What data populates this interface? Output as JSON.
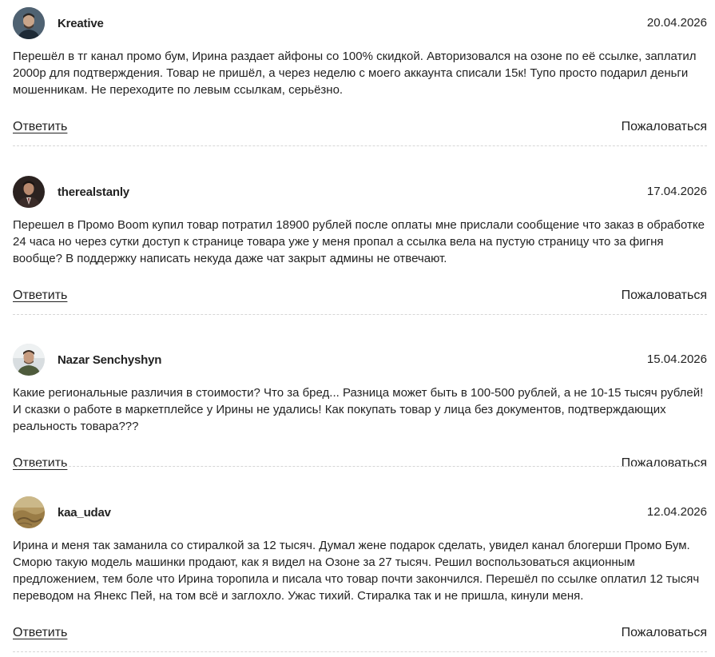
{
  "comments": [
    {
      "author": "Kreative",
      "date": "20.04.2026",
      "avatar_icon": "user-avatar-icon",
      "text": "Перешёл в тг канал промо бум, Ирина раздает айфоны со 100% скидкой. Авторизовался на озоне по её ссылке, заплатил 2000р для подтверждения. Товар не пришёл, а через неделю с моего аккаунта списали 15к! Тупо просто подарил деньги мошенникам. Не переходите по левым ссылкам, серьёзно.",
      "reply_label": "Ответить",
      "report_label": "Пожаловаться"
    },
    {
      "author": "therealstanly",
      "date": "17.04.2026",
      "avatar_icon": "user-avatar-icon",
      "text": "Перешел в Промо Boom купил товар потратил 18900 рублей после оплаты мне прислали сообщение что заказ в обработке 24 часа но через сутки доступ к странице товара уже у меня пропал а ссылка вела на пустую страницу что за фигня вообще? В поддержку написать некуда даже чат закрыт админы не отвечают.",
      "reply_label": "Ответить",
      "report_label": "Пожаловаться"
    },
    {
      "author": "Nazar Senchyshyn",
      "date": "15.04.2026",
      "avatar_icon": "user-avatar-icon",
      "text": "Какие региональные различия в стоимости? Что за бред... Разница может быть в 100-500 рублей, а не 10-15 тысяч рублей! И сказки о работе в маркетплейсе у Ирины не удались! Как покупать товар у лица без документов, подтверждающих реальность товара???",
      "reply_label": "Ответить",
      "report_label": "Пожаловаться"
    },
    {
      "author": "kaa_udav",
      "date": "12.04.2026",
      "avatar_icon": "user-avatar-icon",
      "text": "Ирина и меня так заманила со стиралкой за 12 тысяч. Думал жене подарок сделать, увидел канал блогерши Промо Бум. Сморю такую модель машинки продают, как я видел на Озоне за 27 тысяч. Решил воспользоваться акционным предложением, тем боле что Ирина торопила и писала что товар почти закончился. Перешёл по ссылке оплатил 12 тысяч переводом на Янекс Пей, на том всё и заглохло. Ужас тихий. Стиралка так и не пришла, кинули меня.",
      "reply_label": "Ответить",
      "report_label": "Пожаловаться"
    }
  ],
  "colors": {
    "text": "#222222",
    "divider": "#d6d6d6",
    "background": "#ffffff"
  }
}
